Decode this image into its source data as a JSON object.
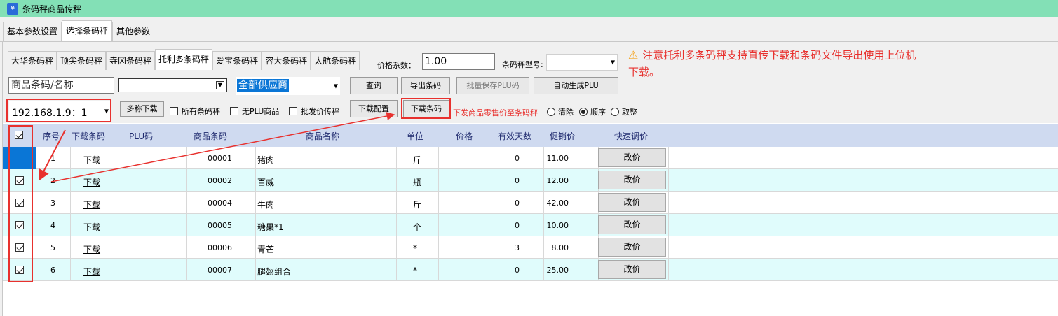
{
  "window": {
    "title": "条码秤商品传秤",
    "icon": "¥"
  },
  "top_tabs": [
    "基本参数设置",
    "选择条码秤",
    "其他参数"
  ],
  "top_tab_active": 1,
  "scale_tabs": [
    "大华条码秤",
    "顶尖条码秤",
    "寺冈条码秤",
    "托利多条码秤",
    "爱宝条码秤",
    "容大条码秤",
    "太航条码秤"
  ],
  "scale_tab_active": 3,
  "price_coef": {
    "label": "价格系数：",
    "value": "1.00"
  },
  "scale_model": {
    "label": "条码秤型号:",
    "value": ""
  },
  "warning": "注意托利多条码秤支持直传下载和条码文件导出使用上位机下载。",
  "search": {
    "placeholder": "商品条码/名称"
  },
  "category_value": "",
  "supplier_value": "全部供应商",
  "buttons": {
    "query": "查询",
    "export": "导出条码",
    "batch_save": "批量保存PLU码",
    "auto_plu": "自动生成PLU",
    "multi_download": "多称下载",
    "download_config": "下载配置",
    "download_barcode": "下载条码"
  },
  "ip_value": "192.168.1.9：1",
  "checkboxes": {
    "all_barcodes": "所有条码秤",
    "no_plu": "无PLU商品",
    "wholesale": "批发价传秤"
  },
  "send_price_label": "下发商品零售价至条码秤",
  "radios": {
    "clear": "清除",
    "order": "顺序",
    "round": "取整",
    "selected": "顺序"
  },
  "table": {
    "headers": [
      "序号",
      "下载条码",
      "PLU码",
      "商品条码",
      "商品名称",
      "单位",
      "价格",
      "有效天数",
      "促销价",
      "快速调价"
    ],
    "rows": [
      {
        "no": "1",
        "dl": "下载",
        "plu": "",
        "barcode": "00001",
        "name": "猪肉",
        "unit": "斤",
        "price": "11.00",
        "days": "0",
        "promo": "",
        "action": "改价"
      },
      {
        "no": "2",
        "dl": "下载",
        "plu": "",
        "barcode": "00002",
        "name": "百威",
        "unit": "瓶",
        "price": "12.00",
        "days": "0",
        "promo": "",
        "action": "改价"
      },
      {
        "no": "3",
        "dl": "下载",
        "plu": "",
        "barcode": "00004",
        "name": "牛肉",
        "unit": "斤",
        "price": "42.00",
        "days": "0",
        "promo": "",
        "action": "改价"
      },
      {
        "no": "4",
        "dl": "下载",
        "plu": "",
        "barcode": "00005",
        "name": "糖果*1",
        "unit": "个",
        "price": "10.00",
        "days": "0",
        "promo": "",
        "action": "改价"
      },
      {
        "no": "5",
        "dl": "下载",
        "plu": "",
        "barcode": "00006",
        "name": "青芒",
        "unit": "*",
        "price": "8.00",
        "days": "3",
        "promo": "",
        "action": "改价"
      },
      {
        "no": "6",
        "dl": "下载",
        "plu": "",
        "barcode": "00007",
        "name": "腿翅组合",
        "unit": "*",
        "price": "25.00",
        "days": "0",
        "promo": "",
        "action": "改价"
      }
    ]
  },
  "colors": {
    "annotation": "#e8312e",
    "titlebar": "#83e0b6",
    "header": "#cfdaf0",
    "alt_row": "#e0fcfc"
  }
}
